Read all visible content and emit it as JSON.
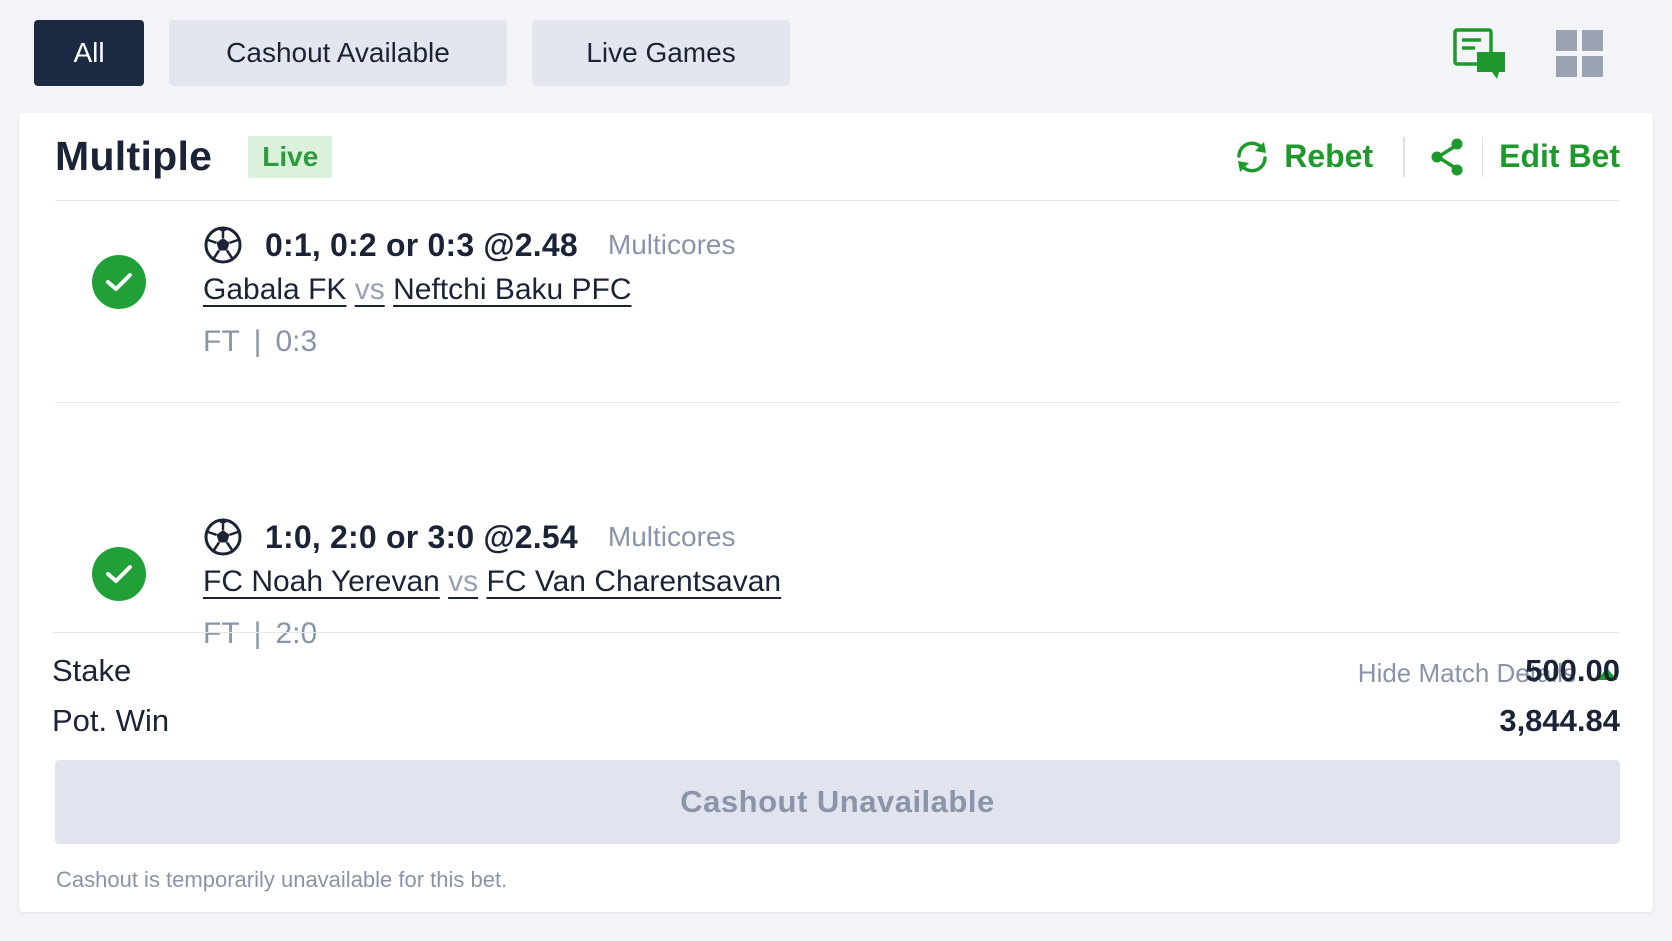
{
  "filters": {
    "all": "All",
    "cashout_available": "Cashout Available",
    "live_games": "Live Games"
  },
  "top_icons": [
    "bet-chat-icon",
    "grid-view-icon"
  ],
  "bet": {
    "title": "Multiple",
    "badge": "Live",
    "actions": {
      "rebet": "Rebet",
      "edit_bet": "Edit Bet"
    },
    "selections": [
      {
        "pick": "0:1, 0:2 or 0:3 @2.48",
        "market": "Multicores",
        "home": "Gabala FK",
        "vs": "vs",
        "away": "Neftchi Baku PFC",
        "status": "FT",
        "score": "0:3"
      },
      {
        "pick": "1:0, 2:0 or 3:0 @2.54",
        "market": "Multicores",
        "home": "FC Noah Yerevan",
        "vs": "vs",
        "away": "FC Van Charentsavan",
        "status": "FT",
        "score": "2:0"
      }
    ],
    "hide_details": "Hide Match Details",
    "stake_label": "Stake",
    "stake_value": "500.00",
    "pot_win_label": "Pot. Win",
    "pot_win_value": "3,844.84",
    "cashout_button": "Cashout Unavailable",
    "cashout_note": "Cashout is temporarily unavailable for this bet."
  },
  "colors": {
    "accent_green": "#1d9a2b",
    "dark_navy": "#1b2a42",
    "muted_text": "#8a94a9",
    "badge_bg": "#dbf0dd"
  }
}
